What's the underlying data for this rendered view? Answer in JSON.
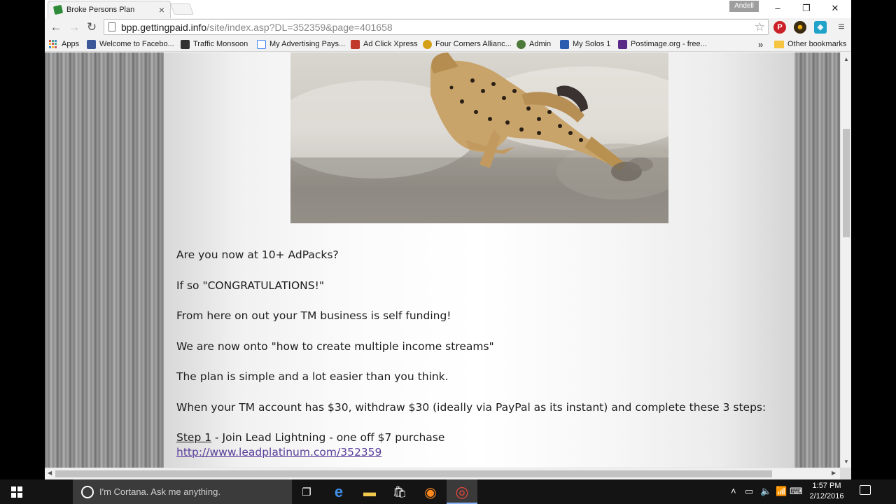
{
  "browser": {
    "tab_title": "Broke Persons Plan",
    "tab_close": "×",
    "profile_name": "Andell",
    "window_controls": {
      "minimize": "–",
      "restore": "❐",
      "close": "✕"
    },
    "nav": {
      "back": "←",
      "forward": "→",
      "reload": "↻"
    },
    "url_host": "bpp.gettingpaid.info",
    "url_path": "/site/index.asp?DL=352359&page=401658",
    "bookmark_star": "☆",
    "menu": "≡",
    "extensions": [
      {
        "name": "pinterest-icon",
        "label": "P",
        "color": "#cb2027"
      },
      {
        "name": "smiley-extension-icon",
        "label": "☻",
        "color": "#3a2a12"
      },
      {
        "name": "diamond-extension-icon",
        "label": "◈",
        "color": "#1fa3c9"
      }
    ],
    "bookmarks": [
      {
        "name": "bookmark-apps",
        "label": "Apps"
      },
      {
        "name": "bookmark-facebook",
        "label": "Welcome to Facebo...",
        "color": "#3b5998"
      },
      {
        "name": "bookmark-traffic-monsoon",
        "label": "Traffic Monsoon",
        "color": "#333333"
      },
      {
        "name": "bookmark-my-advertising",
        "label": "My Advertising Pays...",
        "color": "#4285f4"
      },
      {
        "name": "bookmark-ad-click-xpress",
        "label": "Ad Click Xpress",
        "color": "#c0392b"
      },
      {
        "name": "bookmark-four-corners",
        "label": "Four Corners Allianc...",
        "color": "#d4a017"
      },
      {
        "name": "bookmark-admin",
        "label": "Admin",
        "color": "#4d7a3a"
      },
      {
        "name": "bookmark-my-solos",
        "label": "My Solos 1",
        "color": "#2a5db0"
      },
      {
        "name": "bookmark-postimage",
        "label": "Postimage.org - free...",
        "color": "#5b2a86"
      }
    ],
    "bookmarks_more": "»",
    "other_bookmarks": "Other bookmarks"
  },
  "page": {
    "lines": [
      "Are you now at 10+ AdPacks?",
      "If so \"CONGRATULATIONS!\"",
      "From here on out your TM business is self funding!",
      "We are now onto \"how to create multiple income streams\"",
      "The plan is simple and a lot easier than you think.",
      "When your TM account has $30, withdraw $30 (ideally via PayPal as its instant) and complete these 3 steps:"
    ],
    "step1_label": "Step 1",
    "step1_text": " - Join Lead Lightning - one off $7 purchase",
    "step1_link": "http://www.leadplatinum.com/352359"
  },
  "taskbar": {
    "search_placeholder": "I'm Cortana. Ask me anything.",
    "apps": [
      {
        "name": "task-view-icon",
        "glyph": "❐",
        "color": "#ffffff"
      },
      {
        "name": "edge-icon",
        "glyph": "e",
        "color": "#3f8ee8"
      },
      {
        "name": "file-explorer-icon",
        "glyph": "▬",
        "color": "#f2c94c"
      },
      {
        "name": "store-icon",
        "glyph": "🛍",
        "color": "#ffffff"
      },
      {
        "name": "firefox-icon",
        "glyph": "◉",
        "color": "#ff8a1e"
      },
      {
        "name": "chrome-icon",
        "glyph": "◎",
        "color": "#e4453a"
      }
    ],
    "tray": {
      "chevron": "˄",
      "battery": "▭",
      "volume": "🔈",
      "wifi": "📶",
      "keyboard": "⌨"
    },
    "time": "1:57 PM",
    "date": "2/12/2016"
  }
}
